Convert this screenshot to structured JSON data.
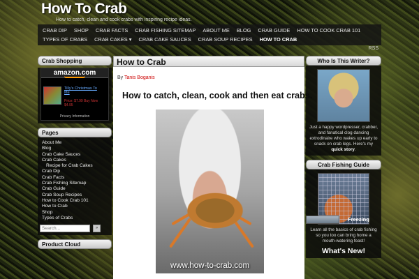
{
  "site": {
    "title": "How To Crab",
    "tagline": "How to catch, clean and cook crabs with inspiring recipe ideas."
  },
  "nav": {
    "items": [
      {
        "label": "CRAB DIP"
      },
      {
        "label": "SHOP"
      },
      {
        "label": "CRAB FACTS"
      },
      {
        "label": "CRAB FISHING SITEMAP"
      },
      {
        "label": "ABOUT ME"
      },
      {
        "label": "BLOG"
      },
      {
        "label": "CRAB GUIDE"
      },
      {
        "label": "HOW TO COOK CRAB 101"
      },
      {
        "label": "TYPES OF CRABS"
      },
      {
        "label": "CRAB CAKES ▾"
      },
      {
        "label": "CRAB CAKE SAUCES"
      },
      {
        "label": "CRAB SOUP RECIPES"
      },
      {
        "label": "HOW TO CRAB"
      }
    ],
    "rss": "RSS"
  },
  "left_sidebar": {
    "shopping_title": "Crab Shopping",
    "amazon": {
      "logo": "amazon.com",
      "product_link": "Tilly's Christmas To Me",
      "price": "Price: $7.99 Buy Now $4.95",
      "privacy": "Privacy Information"
    },
    "pages_title": "Pages",
    "pages": [
      {
        "label": "About Me",
        "sub": false
      },
      {
        "label": "Blog",
        "sub": false
      },
      {
        "label": "Crab Cake Sauces",
        "sub": false
      },
      {
        "label": "Crab Cakes",
        "sub": false
      },
      {
        "label": "Recipe for Crab Cakes",
        "sub": true
      },
      {
        "label": "Crab Dip",
        "sub": false
      },
      {
        "label": "Crab Facts",
        "sub": false
      },
      {
        "label": "Crab Fishing Sitemap",
        "sub": false
      },
      {
        "label": "Crab Guide",
        "sub": false
      },
      {
        "label": "Crab Soup Recipes",
        "sub": false
      },
      {
        "label": "How to Cook Crab 101",
        "sub": false
      },
      {
        "label": "How to Crab",
        "sub": false
      },
      {
        "label": "Shop",
        "sub": false
      },
      {
        "label": "Types of Crabs",
        "sub": false
      }
    ],
    "search": {
      "placeholder": "Search...",
      "button": "»"
    },
    "product_cloud_title": "Product Cloud"
  },
  "main": {
    "title": "How to Crab",
    "byline_prefix": "By",
    "author": "Tanis Boganis",
    "headline": "How to catch, clean, cook and then eat crabs.",
    "photo_watermark": "www.how-to-crab.com"
  },
  "right_sidebar": {
    "writer_title": "Who Is This Writer?",
    "writer_text": "Just a happy wordpresser, crabber, and fanatical clog dancing extrodinaire who wakes up early to snack on crab legs. Here's my",
    "writer_link": "quick story",
    "guide_title": "Crab Fishing Guide",
    "guide_text": "Learn all the basics of crab fishing so you too can bring home a mouth-watering feast!",
    "whats_new_title": "What's New!",
    "new_item_label": "Freezing"
  }
}
